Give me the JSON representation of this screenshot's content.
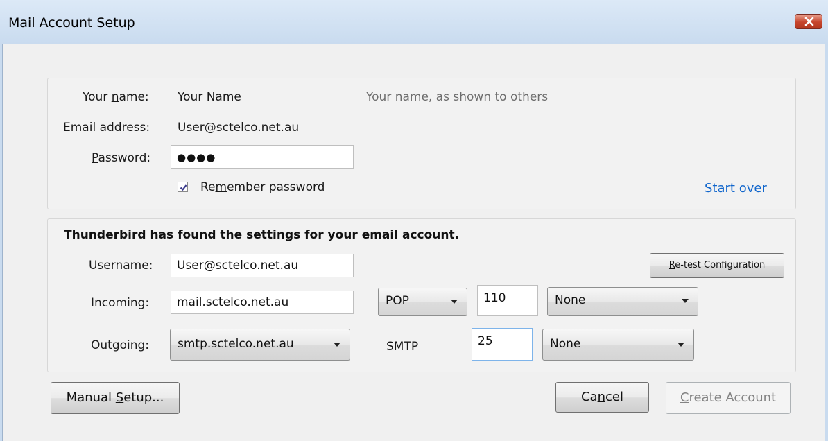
{
  "window": {
    "title": "Mail Account Setup",
    "close_icon": "close-icon"
  },
  "identity": {
    "name_label_pre": "Your ",
    "name_label_key": "n",
    "name_label_post": "ame:",
    "name_value": "Your Name",
    "name_hint": "Your name, as shown to others",
    "email_label_pre": "Emai",
    "email_label_key": "l",
    "email_label_post": " address:",
    "email_value": "User@sctelco.net.au",
    "password_label_key": "P",
    "password_label_post": "assword:",
    "password_value": "●●●●",
    "remember_checked": true,
    "remember_label_pre": "Re",
    "remember_label_key": "m",
    "remember_label_post": "ember password",
    "start_over": "Start over"
  },
  "settings": {
    "heading": "Thunderbird has found the settings for your email account.",
    "username_label": "Username:",
    "username_value": "User@sctelco.net.au",
    "retest_key": "R",
    "retest_rest": "e-test Configuration",
    "incoming_label": "Incoming:",
    "incoming_value": "mail.sctelco.net.au",
    "incoming_protocol": "POP",
    "incoming_port": "110",
    "incoming_security": "None",
    "outgoing_label": "Outgoing:",
    "outgoing_value": "smtp.sctelco.net.au",
    "outgoing_protocol": "SMTP",
    "outgoing_port": "25",
    "outgoing_security": "None"
  },
  "buttons": {
    "manual_pre": "Manual ",
    "manual_key": "S",
    "manual_post": "etup...",
    "cancel_pre": "Ca",
    "cancel_key": "n",
    "cancel_post": "cel",
    "create_key": "C",
    "create_post": "reate Account"
  },
  "colors": {
    "link": "#1166cc",
    "close": "#c6452d",
    "focus_border": "#7eb4ea"
  }
}
